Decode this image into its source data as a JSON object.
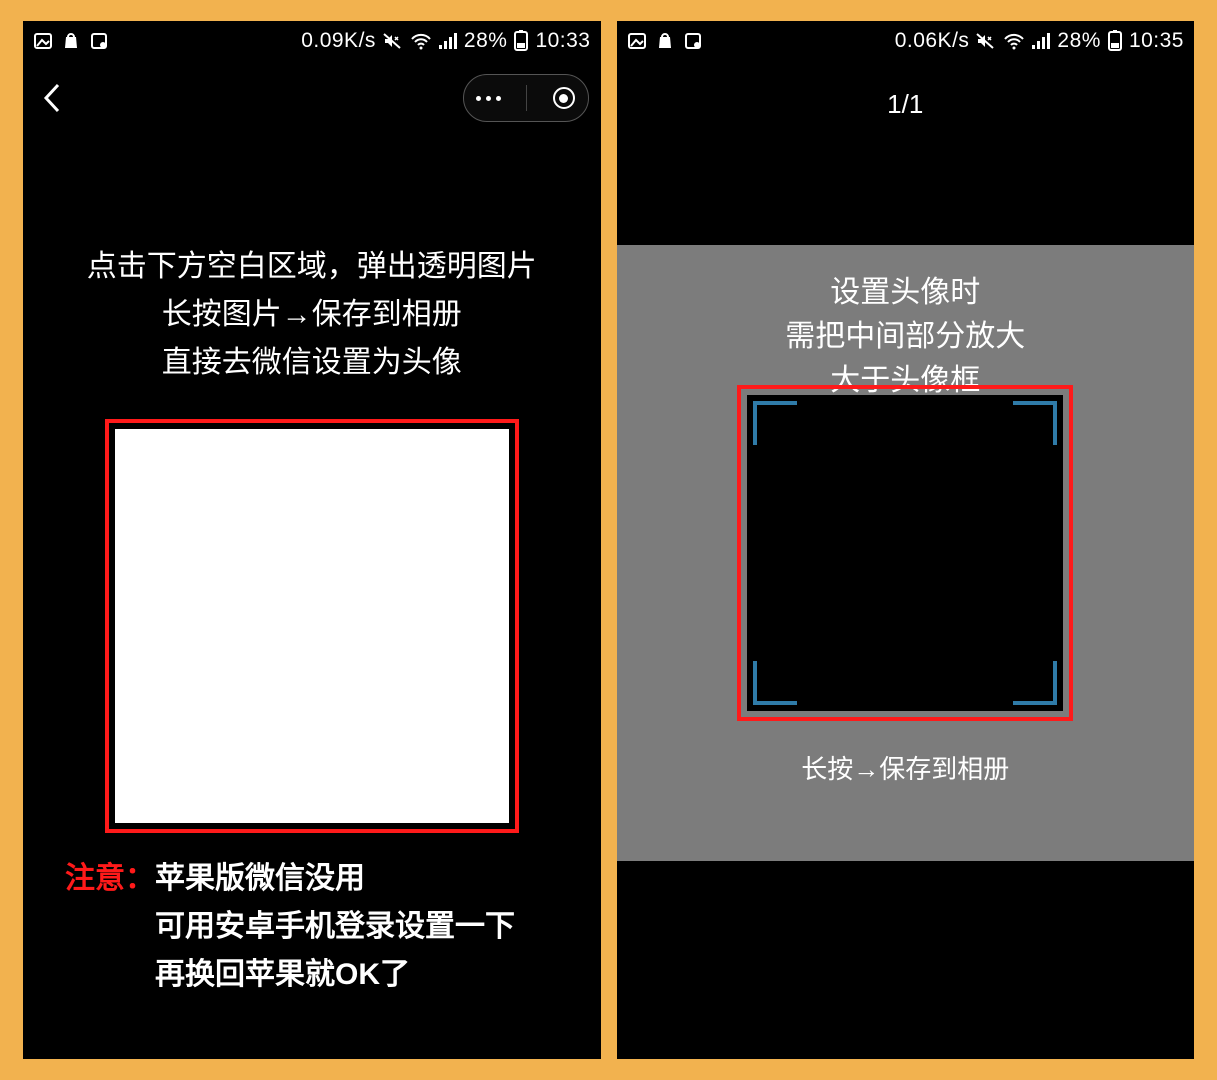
{
  "left": {
    "status": {
      "speed": "0.09K/s",
      "battery": "28%",
      "time": "10:33"
    },
    "instr_line1": "点击下方空白区域，弹出透明图片",
    "instr_line2": "长按图片→保存到相册",
    "instr_line3": "直接去微信设置为头像",
    "note_tag": "注意：",
    "note_line1": "苹果版微信没用",
    "note_line2": "可用安卓手机登录设置一下",
    "note_line3": "再换回苹果就OK了"
  },
  "right": {
    "status": {
      "speed": "0.06K/s",
      "battery": "28%",
      "time": "10:35"
    },
    "counter": "1/1",
    "gp_line1": "设置头像时",
    "gp_line2": "需把中间部分放大",
    "gp_line3": "大于头像框",
    "gp_bottom": "长按→保存到相册"
  }
}
